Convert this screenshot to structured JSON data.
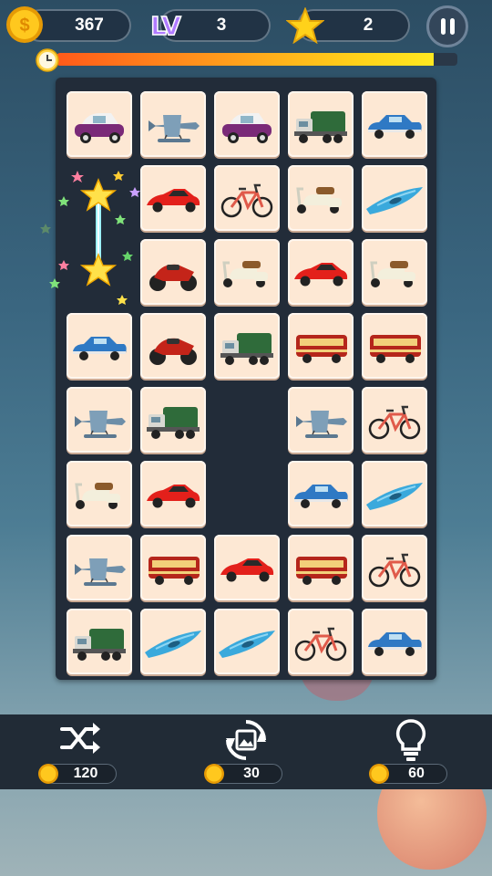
{
  "hud": {
    "coins": "367",
    "level_label": "LV",
    "level": "3",
    "stars": "2",
    "timer_fraction": 0.94
  },
  "icons": {
    "coin": "coin-icon",
    "level": "level-icon",
    "star": "star-icon",
    "pause": "pause-icon",
    "clock": "clock-icon"
  },
  "board": {
    "columns": 5,
    "rows": 8,
    "tiles": [
      [
        "vintage-car",
        "seaplane",
        "vintage-car",
        "garbage-truck",
        "classic-car"
      ],
      [
        "",
        "sports-car",
        "bicycle",
        "scooter",
        "kayak"
      ],
      [
        "",
        "motorcycle",
        "scooter",
        "sports-car",
        "scooter"
      ],
      [
        "classic-car",
        "motorcycle",
        "garbage-truck",
        "bus",
        "bus"
      ],
      [
        "seaplane",
        "garbage-truck",
        "",
        "seaplane",
        "bicycle"
      ],
      [
        "scooter",
        "sports-car",
        "",
        "classic-car",
        "kayak"
      ],
      [
        "seaplane",
        "bus",
        "sports-car",
        "bus",
        "bicycle"
      ],
      [
        "garbage-truck",
        "kayak",
        "kayak",
        "bicycle",
        "classic-car"
      ]
    ]
  },
  "tools": [
    {
      "name": "shuffle",
      "cost": "120"
    },
    {
      "name": "refresh-image",
      "cost": "30"
    },
    {
      "name": "hint",
      "cost": "60"
    }
  ],
  "colors": {
    "tile": "#fde8d4",
    "board": "#222c39",
    "coin": "#f5b90f",
    "star": "#ffd21a"
  }
}
